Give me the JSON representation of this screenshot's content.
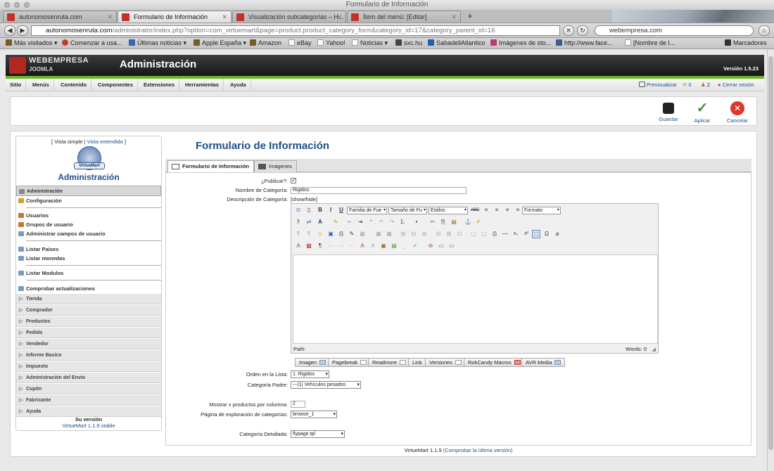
{
  "browser": {
    "window_title": "Formulario de Información",
    "tabs": [
      {
        "label": "autonomosenruta.com",
        "active": false
      },
      {
        "label": "Formulario de Información",
        "active": true
      },
      {
        "label": "Visualización subcategorías – H...",
        "active": false
      },
      {
        "label": "Ítem del menú: [Editar]",
        "active": false
      }
    ],
    "url_domain": "autonomosenruta.com",
    "url_path": "/administrator/index.php?option=com_virtuemart&page=product.product_category_form&category_id=17&category_parent_id=16",
    "search_value": "webempresa.com",
    "bookmarks": [
      "Más visitados ▾",
      "Comenzar a usa...",
      "Últimas noticias ▾",
      "Apple España ▾",
      "Amazon",
      "eBay",
      "Yahoo!",
      "Noticias ▾",
      "sxc.hu",
      "SabadellAtlantico",
      "Imágenes de sto...",
      "http://www.face...",
      "[Nombre de l...",
      "Marcadores"
    ]
  },
  "header": {
    "brand": "WEBEMPRESA",
    "brand_sub": "JOOMLA",
    "title": "Administración",
    "version": "Versión 1.5.23"
  },
  "menu": {
    "items": [
      "Sitio",
      "Menús",
      "Contenido",
      "Componentes",
      "Extensiones",
      "Herramientas",
      "Ayuda"
    ],
    "preview": "Previsualizar",
    "messages": "0",
    "users": "2",
    "logout": "Cerrar sesión"
  },
  "toolbar": {
    "save": "Guardar",
    "apply": "Aplicar",
    "cancel": "Cancelar"
  },
  "left": {
    "view_prefix": "[ Vista simple |",
    "view_extended": "Vista extendida",
    "view_suffix": "]",
    "logo_text": "VirtueMart",
    "admin_title": "Administración",
    "selected": "Administración",
    "links": [
      "Configuración",
      "Usuarios",
      "Grupos de usuario",
      "Administrar campos de usuario",
      "Listar Países",
      "Listar monedas",
      "Listar Modulos",
      "Comprobar actualizaciones"
    ],
    "sections": [
      "Tienda",
      "Comprador",
      "Productos",
      "Pedido",
      "Vendedor",
      "Informe Basico",
      "Impuesto",
      "Administración del Envío",
      "Cupón",
      "Fabricante",
      "Ayuda"
    ],
    "version_label": "Su versión",
    "version_value": "VirtueMart 1.1.9 stable"
  },
  "form": {
    "title": "Formulario de Información",
    "tab_info": "Formulario de Información",
    "tab_images": "Imágenes",
    "publish_label": "¿Publicar?:",
    "name_label": "Nombre de Categoría:",
    "name_value": "Rigidos",
    "desc_label": "Descripción de Categoría:",
    "desc_toggle": "[show/hide]",
    "editor": {
      "font_family": "Familia de Fue",
      "font_size": "Tamaño de Fu",
      "styles": "Estilos",
      "format": "Formato",
      "path_label": "Path:",
      "words": "Words: 0"
    },
    "xtd_buttons": [
      "Imagen",
      "Pagebreak",
      "Readmore",
      "Link",
      "Versiones",
      "RokCandy Macros",
      "AVR Media"
    ],
    "order_label": "Orden en la Lista:",
    "order_value": "1. Rigidos",
    "parent_label": "Categoría Padre:",
    "parent_value": "---|1| Vehículos pesados",
    "perrow_label": "Mostrar x productos por columna:",
    "perrow_value": "2",
    "browse_label": "Página de exploración de categorías:",
    "browse_value": "browse_1",
    "flypage_label": "Categoría Detallada:",
    "flypage_value": "flypage.tpl"
  },
  "footer": {
    "version": "VirtueMart 1.1.9",
    "check_link": "(Comprobar la última versión)"
  }
}
